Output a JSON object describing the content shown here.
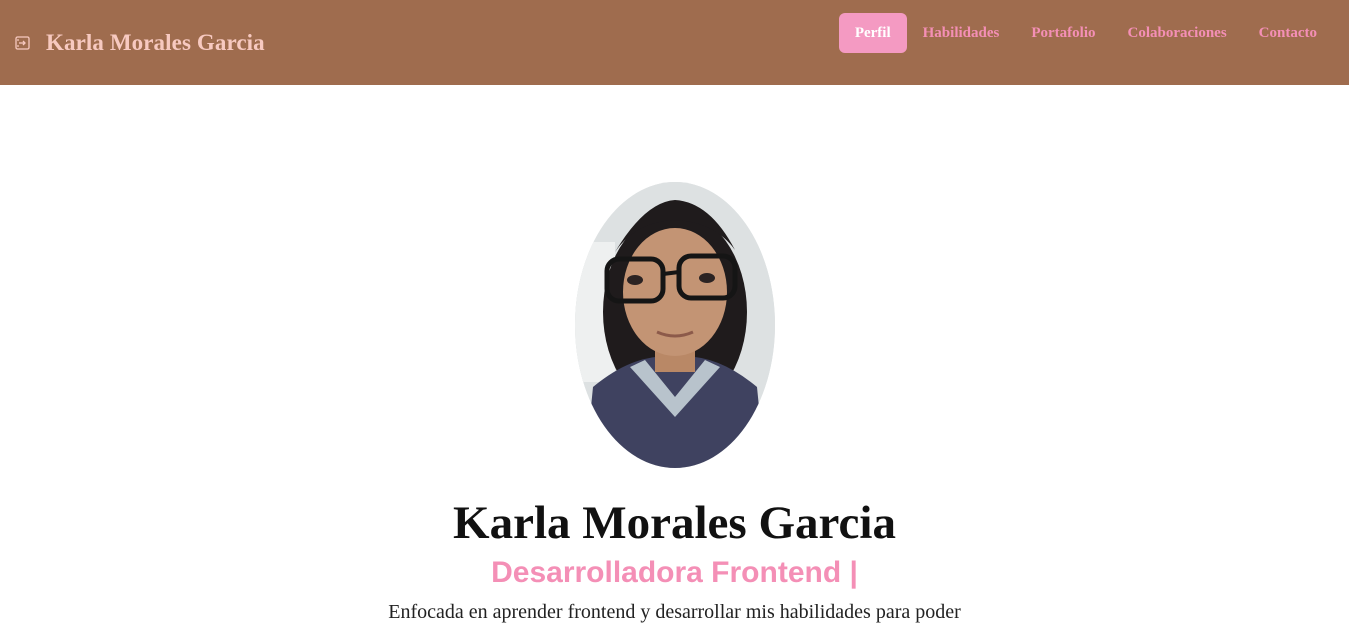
{
  "navbar": {
    "brand_icon": "login-icon",
    "brand_name": "Karla Morales Garcia",
    "links": [
      {
        "label": "Perfil",
        "active": true
      },
      {
        "label": "Habilidades",
        "active": false
      },
      {
        "label": "Portafolio",
        "active": false
      },
      {
        "label": "Colaboraciones",
        "active": false
      },
      {
        "label": "Contacto",
        "active": false
      }
    ],
    "colors": {
      "background": "#9f6c4e",
      "brand_text": "#f7c9c0",
      "link_text": "#f48fb6",
      "active_bg": "#f49ac2"
    }
  },
  "hero": {
    "photo_alt": "profile-photo",
    "name": "Karla Morales Garcia",
    "role": "Desarrolladora Frontend |",
    "description": "Enfocada en aprender frontend y desarrollar mis habilidades para poder"
  }
}
